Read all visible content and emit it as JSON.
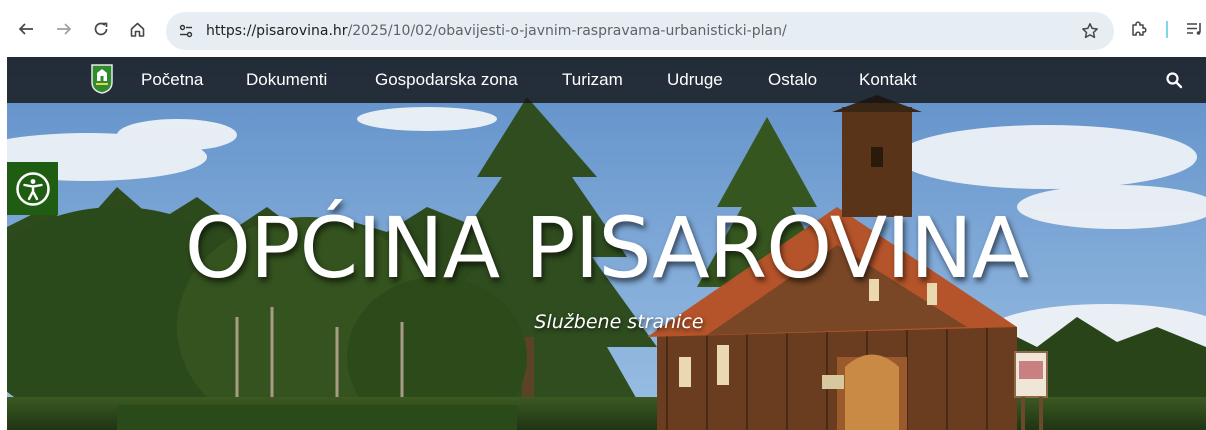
{
  "browser": {
    "url_host": "https://pisarovina.hr",
    "url_path": "/2025/10/02/obavijesti-o-javnim-raspravama-urbanisticki-plan/",
    "icons": {
      "back": "arrow-left-icon",
      "forward": "arrow-right-icon",
      "reload": "reload-icon",
      "home": "home-icon",
      "site_info": "tune-icon",
      "bookmark": "star-icon",
      "extensions": "puzzle-icon",
      "reading_list": "reading-list-icon"
    }
  },
  "site": {
    "nav": {
      "items": [
        "Početna",
        "Dokumenti",
        "Gospodarska zona",
        "Turizam",
        "Udruge",
        "Ostalo",
        "Kontakt"
      ]
    },
    "hero": {
      "title": "OPĆINA PISAROVINA",
      "subtitle": "Službene stranice"
    },
    "colors": {
      "nav_background": "#141414",
      "accessibility_button": "#1f5e12",
      "logo_green": "#2e8b2e"
    }
  }
}
